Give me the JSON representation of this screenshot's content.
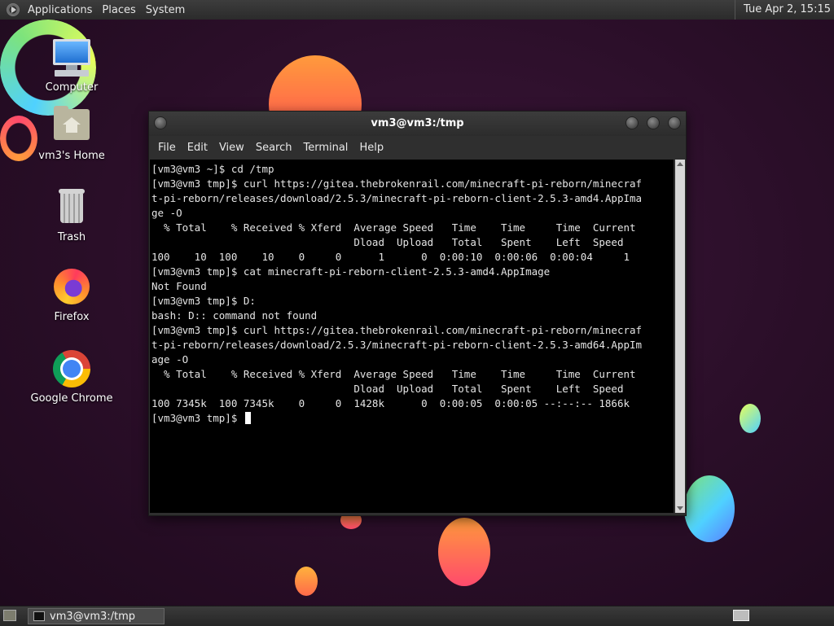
{
  "top_panel": {
    "menus": [
      "Applications",
      "Places",
      "System"
    ],
    "clock": "Tue Apr  2, 15:15"
  },
  "desktop_icons": [
    {
      "label": "Computer"
    },
    {
      "label": "vm3's Home"
    },
    {
      "label": "Trash"
    },
    {
      "label": "Firefox"
    },
    {
      "label": "Google Chrome"
    }
  ],
  "terminal": {
    "title": "vm3@vm3:/tmp",
    "menus": [
      "File",
      "Edit",
      "View",
      "Search",
      "Terminal",
      "Help"
    ],
    "output": "[vm3@vm3 ~]$ cd /tmp\n[vm3@vm3 tmp]$ curl https://gitea.thebrokenrail.com/minecraft-pi-reborn/minecraf\nt-pi-reborn/releases/download/2.5.3/minecraft-pi-reborn-client-2.5.3-amd4.AppIma\nge -O\n  % Total    % Received % Xferd  Average Speed   Time    Time     Time  Current\n                                 Dload  Upload   Total   Spent    Left  Speed\n100    10  100    10    0     0      1      0  0:00:10  0:00:06  0:00:04     1\n[vm3@vm3 tmp]$ cat minecraft-pi-reborn-client-2.5.3-amd4.AppImage\nNot Found\n[vm3@vm3 tmp]$ D:\nbash: D:: command not found\n[vm3@vm3 tmp]$ curl https://gitea.thebrokenrail.com/minecraft-pi-reborn/minecraf\nt-pi-reborn/releases/download/2.5.3/minecraft-pi-reborn-client-2.5.3-amd64.AppIm\nage -O\n  % Total    % Received % Xferd  Average Speed   Time    Time     Time  Current\n                                 Dload  Upload   Total   Spent    Left  Speed\n100 7345k  100 7345k    0     0  1428k      0  0:00:05  0:00:05 --:--:-- 1866k\n[vm3@vm3 tmp]$ "
  },
  "taskbar": {
    "task_label": "vm3@vm3:/tmp"
  }
}
